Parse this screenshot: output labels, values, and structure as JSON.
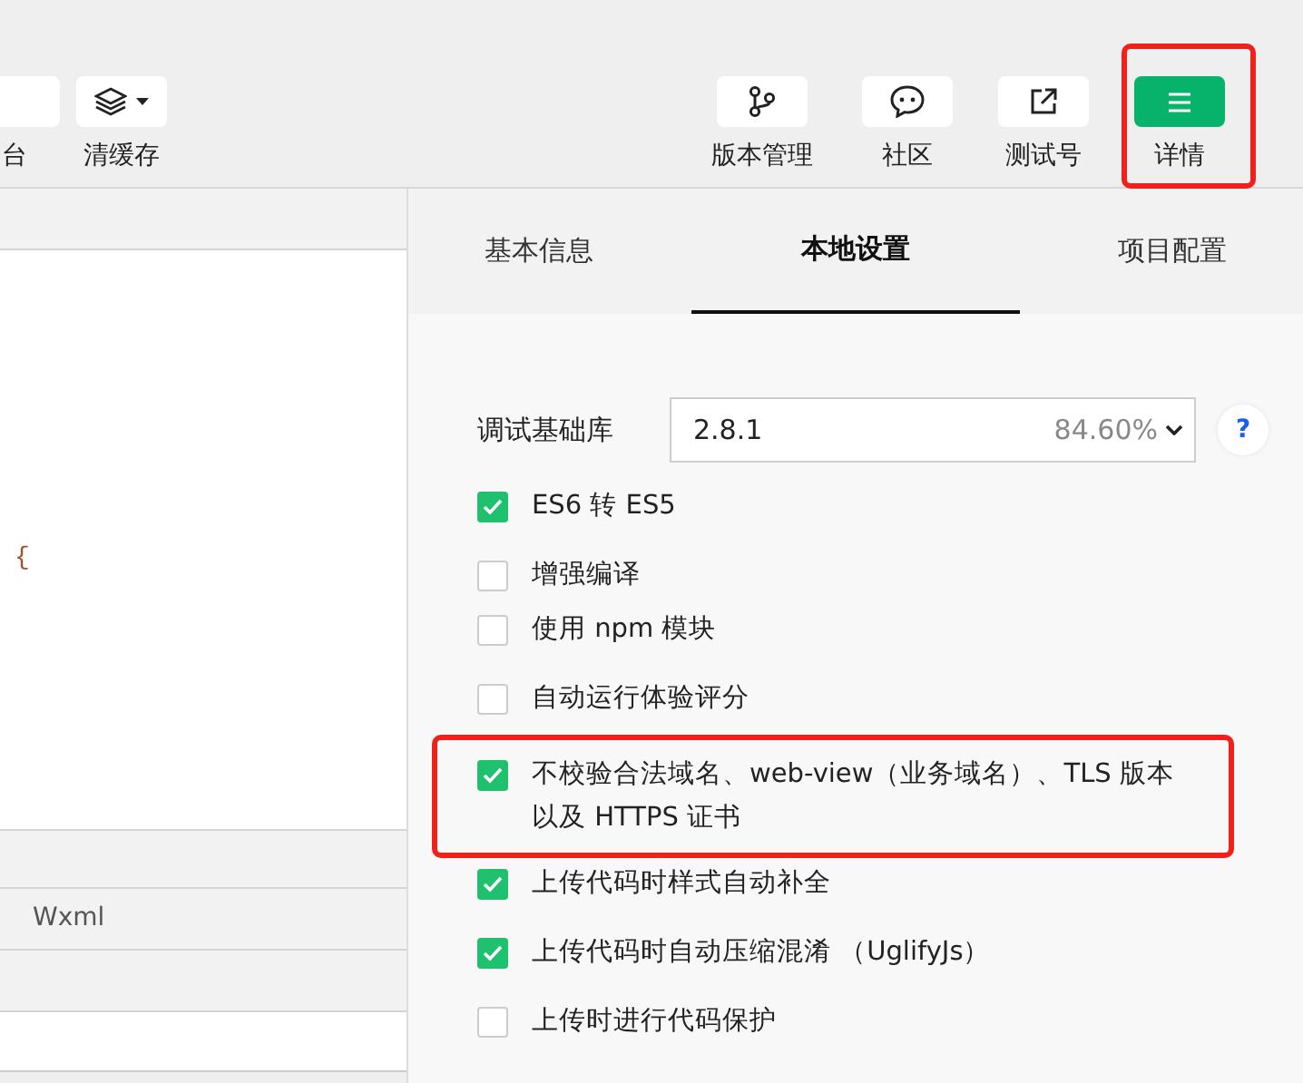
{
  "toolbar": {
    "left_items": [
      {
        "label": "台",
        "selected": false,
        "highlighted": false
      },
      {
        "label": "清缓存",
        "selected": false,
        "highlighted": false,
        "has_dropdown": true
      }
    ],
    "right_items": [
      {
        "label": "版本管理",
        "selected": false,
        "highlighted": false
      },
      {
        "label": "社区",
        "selected": false,
        "highlighted": false
      },
      {
        "label": "测试号",
        "selected": false,
        "highlighted": false
      },
      {
        "label": "详情",
        "selected": true,
        "highlighted": true
      }
    ]
  },
  "editor": {
    "code": "{",
    "panel_tab": "Wxml"
  },
  "details": {
    "tabs": [
      {
        "label": "基本信息",
        "selected": false
      },
      {
        "label": "本地设置",
        "selected": true
      },
      {
        "label": "项目配置",
        "selected": false
      }
    ],
    "library": {
      "label": "调试基础库",
      "value": "2.8.1",
      "usage": "84.60%",
      "help": "?"
    },
    "options": [
      {
        "label": "ES6 转 ES5",
        "checked": true,
        "highlighted": false
      },
      {
        "label": "增强编译",
        "checked": false,
        "highlighted": false
      },
      {
        "label": "使用 npm 模块",
        "checked": false,
        "highlighted": false
      },
      {
        "label": "自动运行体验评分",
        "checked": false,
        "highlighted": false
      },
      {
        "label": "不校验合法域名、web-view（业务域名）、TLS 版本以及 HTTPS 证书",
        "checked": true,
        "highlighted": true
      },
      {
        "label": "上传代码时样式自动补全",
        "checked": true,
        "highlighted": false
      },
      {
        "label": "上传代码时自动压缩混淆 （UglifyJs）",
        "checked": true,
        "highlighted": false
      },
      {
        "label": "上传时进行代码保护",
        "checked": false,
        "highlighted": false
      }
    ]
  }
}
